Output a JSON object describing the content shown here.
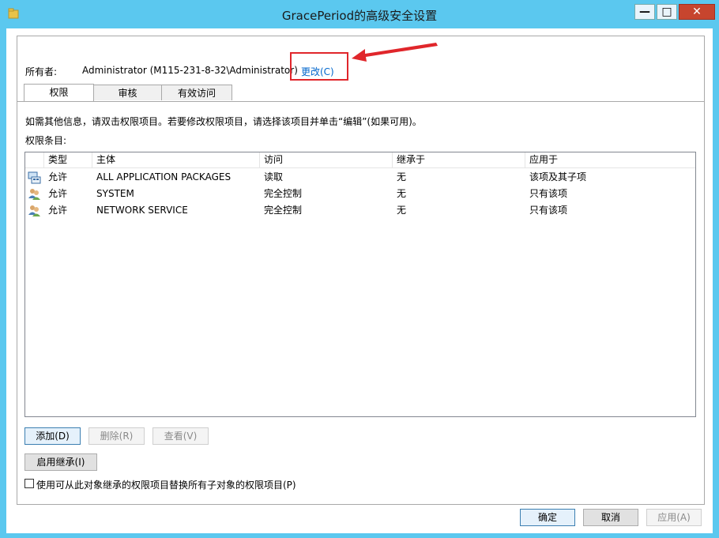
{
  "window": {
    "title": "GracePeriod的高级安全设置",
    "buttons": {
      "minimize": "—",
      "maximize": "□",
      "close": "✕"
    }
  },
  "owner": {
    "label": "所有者:",
    "value": "Administrator (M115-231-8-32\\Administrator)",
    "change_link": "更改(C)"
  },
  "tabs": [
    {
      "label": "权限",
      "active": true
    },
    {
      "label": "审核",
      "active": false
    },
    {
      "label": "有效访问",
      "active": false
    }
  ],
  "info_text": "如需其他信息，请双击权限项目。若要修改权限项目，请选择该项目并单击“编辑”(如果可用)。",
  "entries_label": "权限条目:",
  "table": {
    "columns": [
      "类型",
      "主体",
      "访问",
      "继承于",
      "应用于"
    ],
    "rows": [
      {
        "icon": "app-packages-icon",
        "type": "允许",
        "principal": "ALL APPLICATION PACKAGES",
        "access": "读取",
        "inherited": "无",
        "applies": "该项及其子项"
      },
      {
        "icon": "user-group-icon",
        "type": "允许",
        "principal": "SYSTEM",
        "access": "完全控制",
        "inherited": "无",
        "applies": "只有该项"
      },
      {
        "icon": "user-group-icon",
        "type": "允许",
        "principal": "NETWORK SERVICE",
        "access": "完全控制",
        "inherited": "无",
        "applies": "只有该项"
      }
    ]
  },
  "actions": {
    "add": "添加(D)",
    "remove": "删除(R)",
    "view": "查看(V)",
    "enable_inheritance": "启用继承(I)"
  },
  "checkbox": {
    "label": "使用可从此对象继承的权限项目替换所有子对象的权限项目(P)",
    "checked": false
  },
  "footer": {
    "ok": "确定",
    "cancel": "取消",
    "apply": "应用(A)"
  },
  "colors": {
    "titlebar": "#5bc8ef",
    "link": "#0066cc",
    "annotation": "#e0262b",
    "close_button": "#c7452e"
  }
}
